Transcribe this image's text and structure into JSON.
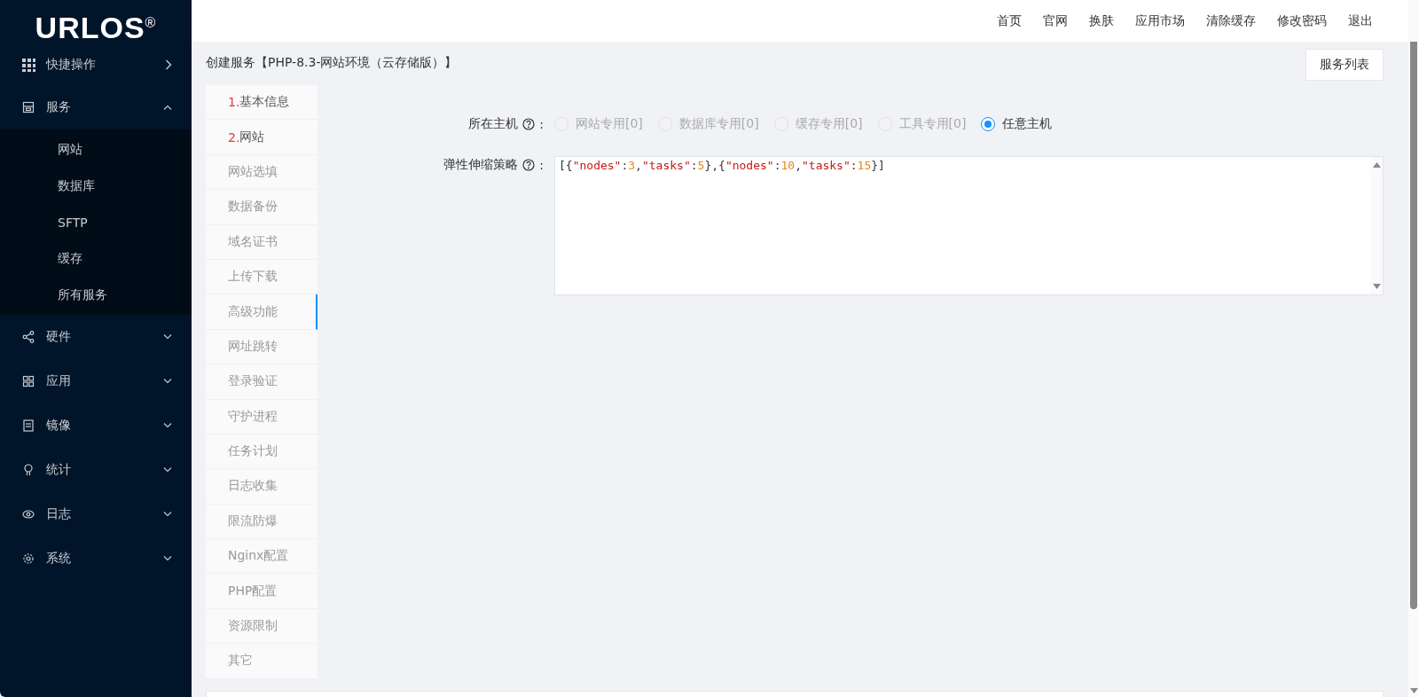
{
  "sidebar": {
    "logo": "URLOS$^{®}$",
    "items": [
      {
        "label": "快捷操作",
        "kind": "link"
      },
      {
        "label": "服务",
        "kind": "group",
        "expanded": true,
        "children": [
          {
            "label": "网站"
          },
          {
            "label": "数据库"
          },
          {
            "label": "SFTP"
          },
          {
            "label": "缓存"
          },
          {
            "label": "所有服务"
          }
        ]
      },
      {
        "label": "硬件",
        "kind": "group",
        "expanded": false
      },
      {
        "label": "应用",
        "kind": "group",
        "expanded": false
      },
      {
        "label": "镜像",
        "kind": "group",
        "expanded": false
      },
      {
        "label": "统计",
        "kind": "group",
        "expanded": false
      },
      {
        "label": "日志",
        "kind": "group",
        "expanded": false
      },
      {
        "label": "系统",
        "kind": "group",
        "expanded": false
      }
    ]
  },
  "top_nav": [
    "首页",
    "官网",
    "换肤",
    "应用市场",
    "清除缓存",
    "修改密码",
    "退出"
  ],
  "page_title": "创建服务【PHP-8.3-网站环境（云存储版）】",
  "service_list_button": "服务列表",
  "steps": [
    {
      "number": "1.",
      "label": "基本信息",
      "done": true,
      "selected": false
    },
    {
      "number": "2.",
      "label": "网站",
      "done": true,
      "selected": false
    },
    {
      "label": "网站选填",
      "done": false,
      "selected": false
    },
    {
      "label": "数据备份",
      "done": false,
      "selected": false
    },
    {
      "label": "域名证书",
      "done": false,
      "selected": false
    },
    {
      "label": "上传下载",
      "done": false,
      "selected": false
    },
    {
      "label": "高级功能",
      "done": false,
      "selected": true
    },
    {
      "label": "网址跳转",
      "done": false,
      "selected": false
    },
    {
      "label": "登录验证",
      "done": false,
      "selected": false
    },
    {
      "label": "守护进程",
      "done": false,
      "selected": false
    },
    {
      "label": "任务计划",
      "done": false,
      "selected": false
    },
    {
      "label": "日志收集",
      "done": false,
      "selected": false
    },
    {
      "label": "限流防爆",
      "done": false,
      "selected": false
    },
    {
      "label": "Nginx配置",
      "done": false,
      "selected": false
    },
    {
      "label": "PHP配置",
      "done": false,
      "selected": false
    },
    {
      "label": "资源限制",
      "done": false,
      "selected": false
    },
    {
      "label": "其它",
      "done": false,
      "selected": false
    }
  ],
  "host_field": {
    "label": "所在主机",
    "colon": ":",
    "options": [
      {
        "label": "网站专用[0]",
        "disabled": true,
        "selected": false
      },
      {
        "label": "数据库专用[0]",
        "disabled": true,
        "selected": false
      },
      {
        "label": "缓存专用[0]",
        "disabled": true,
        "selected": false
      },
      {
        "label": "工具专用[0]",
        "disabled": true,
        "selected": false
      },
      {
        "label": "任意主机",
        "disabled": false,
        "selected": true
      }
    ]
  },
  "scaling_field": {
    "label": "弹性伸缩策略",
    "colon": ":",
    "tokens": [
      {
        "text": "[{",
        "kind": "punct"
      },
      {
        "text": "\"nodes\"",
        "kind": "key"
      },
      {
        "text": ":",
        "kind": "punct"
      },
      {
        "text": "3",
        "kind": "number"
      },
      {
        "text": ",",
        "kind": "punct"
      },
      {
        "text": "\"tasks\"",
        "kind": "key"
      },
      {
        "text": ":",
        "kind": "punct"
      },
      {
        "text": "5",
        "kind": "number"
      },
      {
        "text": "},{",
        "kind": "punct"
      },
      {
        "text": "\"nodes\"",
        "kind": "key"
      },
      {
        "text": ":",
        "kind": "punct"
      },
      {
        "text": "10",
        "kind": "number"
      },
      {
        "text": ",",
        "kind": "punct"
      },
      {
        "text": "\"tasks\"",
        "kind": "key"
      },
      {
        "text": ":",
        "kind": "punct"
      },
      {
        "text": "15",
        "kind": "number"
      },
      {
        "text": "}]",
        "kind": "punct"
      }
    ]
  }
}
